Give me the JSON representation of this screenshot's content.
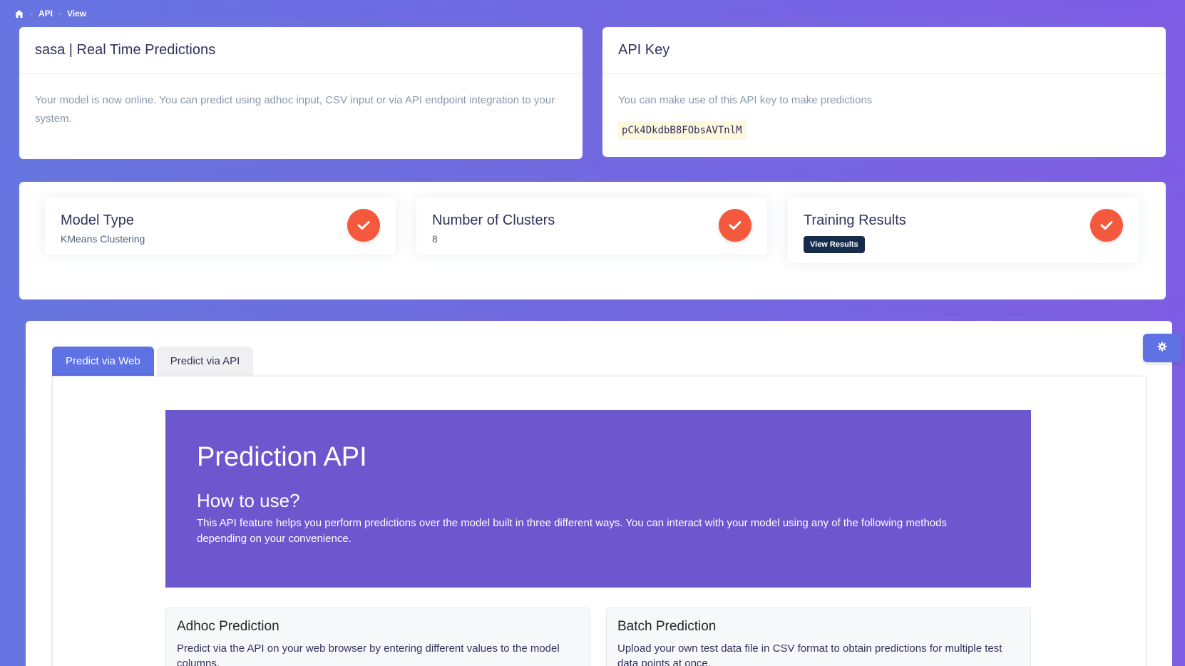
{
  "breadcrumb": {
    "home_icon": "home-icon",
    "items": [
      "API",
      "View"
    ]
  },
  "model_card": {
    "title": "sasa | Real Time Predictions",
    "description": "Your model is now online. You can predict using adhoc input, CSV input or via API endpoint integration to your system."
  },
  "key_card": {
    "title": "API Key",
    "description": "You can make use of this API key to make predictions",
    "key": "pCk4DkdbB8FObsAVTnlM"
  },
  "stats": {
    "model_type": {
      "title": "Model Type",
      "value": "KMeans Clustering"
    },
    "clusters": {
      "title": "Number of Clusters",
      "value": "8"
    },
    "training": {
      "title": "Training Results",
      "button": "View Results"
    },
    "check_color": "#f5593d"
  },
  "tabs": {
    "web": "Predict via Web",
    "api": "Predict via API"
  },
  "jumbotron": {
    "title": "Prediction API",
    "subtitle": "How to use?",
    "text": "This API feature helps you perform predictions over the model built in three different ways. You can interact with your model using any of the following methods depending on your convenience."
  },
  "features": {
    "adhoc": {
      "title": "Adhoc Prediction",
      "text": "Predict via the API on your web browser by entering different values to the model columns."
    },
    "batch": {
      "title": "Batch Prediction",
      "text": "Upload your own test data file in CSV format to obtain predictions for multiple test data points at once."
    }
  },
  "colors": {
    "accent": "#5e72e4",
    "jumbotron": "#6c57ce",
    "dark_button": "#172b4d"
  }
}
